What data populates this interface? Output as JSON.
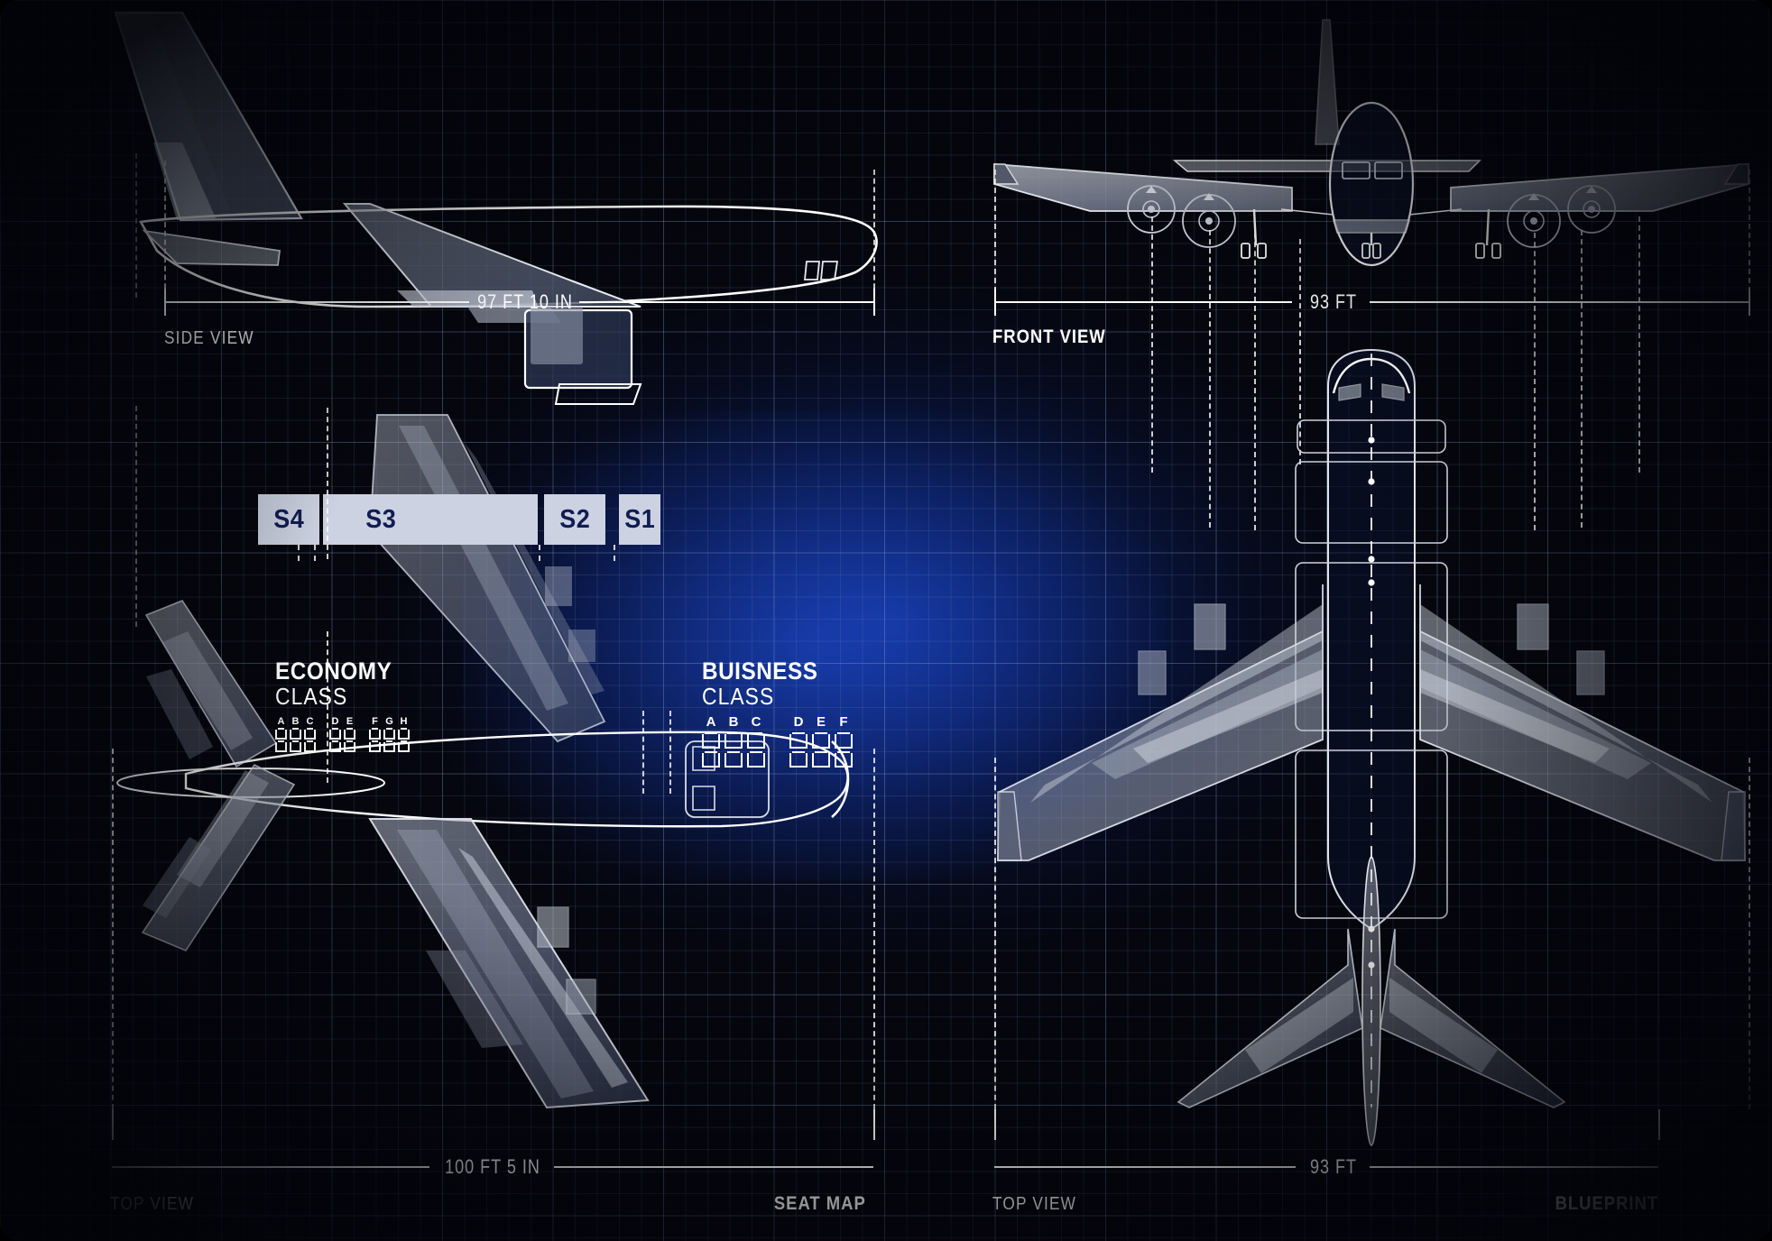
{
  "document": {
    "kind": "aircraft-blueprint",
    "corner_label_bottom_left": "TOP VIEW",
    "background_color": "#05060d",
    "glow_color": "#1234a0",
    "line_color": "#ffffff",
    "seatbar_fill": "#ccd2e1",
    "seatbar_text_color": "#101d52"
  },
  "panels": {
    "side_view": {
      "caption": "SIDE VIEW",
      "dimension": "97 FT 10 IN"
    },
    "front_view": {
      "caption": "FRONT VIEW",
      "dimension": "93 FT"
    },
    "top_view_left": {
      "caption": "TOP VIEW",
      "dimension": "100 FT 5 IN",
      "corner_title": "SEAT  MAP"
    },
    "top_view_right": {
      "caption": "TOP VIEW",
      "dimension": "93 FT",
      "corner_title": "BLUEPRINT"
    }
  },
  "seat_map": {
    "sections": [
      {
        "id": "S4",
        "label": "S4"
      },
      {
        "id": "S3",
        "label": "S3"
      },
      {
        "id": "S2",
        "label": "S2"
      },
      {
        "id": "S1",
        "label": "S1"
      }
    ],
    "classes": [
      {
        "name": "ECONOMY",
        "sub": "CLASS",
        "groups": [
          {
            "letters": [
              "A",
              "B",
              "C"
            ],
            "seats_per_row": 3,
            "rows": 2
          },
          {
            "letters": [
              "D",
              "E"
            ],
            "seats_per_row": 2,
            "rows": 2
          },
          {
            "letters": [
              "F",
              "G",
              "H"
            ],
            "seats_per_row": 3,
            "rows": 2
          }
        ]
      },
      {
        "name": "BUISNESS",
        "sub": "CLASS",
        "groups": [
          {
            "letters": [
              "A",
              "B",
              "C"
            ],
            "seats_per_row": 3,
            "rows": 2
          },
          {
            "letters": [
              "D",
              "E",
              "F"
            ],
            "seats_per_row": 3,
            "rows": 2
          }
        ]
      }
    ]
  }
}
